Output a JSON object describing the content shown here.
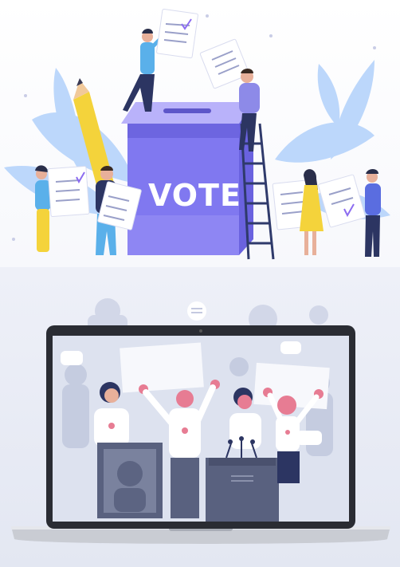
{
  "ballot_box": {
    "label": "VOTE"
  },
  "colors": {
    "box_front": "#8078f0",
    "box_top": "#a79ef7",
    "leaf": "#bcd7fb",
    "pencil": "#f4d33b",
    "laptop_body": "#2a2c33",
    "screen_bg": "#dde2ef",
    "accent_pink": "#e77c93",
    "navy": "#2c3562"
  }
}
